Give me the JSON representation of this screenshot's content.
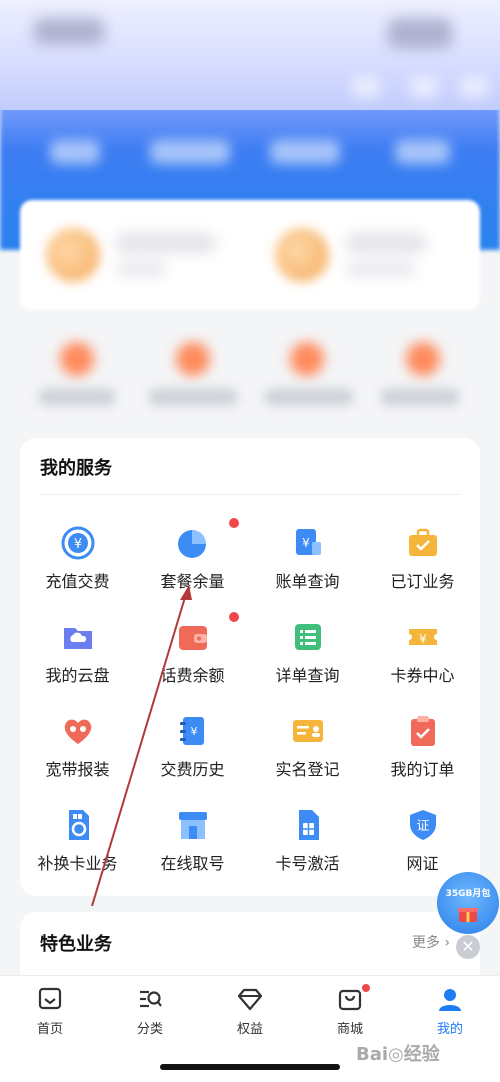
{
  "services": {
    "title": "我的服务",
    "items": [
      {
        "label": "充值交费",
        "icon": "recharge-icon",
        "badge": false
      },
      {
        "label": "套餐余量",
        "icon": "pie-chart-icon",
        "badge": true
      },
      {
        "label": "账单查询",
        "icon": "bill-icon",
        "badge": false
      },
      {
        "label": "已订业务",
        "icon": "briefcase-icon",
        "badge": false
      },
      {
        "label": "我的云盘",
        "icon": "cloud-folder-icon",
        "badge": false
      },
      {
        "label": "话费余额",
        "icon": "wallet-icon",
        "badge": true
      },
      {
        "label": "详单查询",
        "icon": "list-icon",
        "badge": false
      },
      {
        "label": "卡券中心",
        "icon": "coupon-icon",
        "badge": false
      },
      {
        "label": "宽带报装",
        "icon": "heart-icon",
        "badge": false
      },
      {
        "label": "交费历史",
        "icon": "history-icon",
        "badge": false
      },
      {
        "label": "实名登记",
        "icon": "id-card-icon",
        "badge": false
      },
      {
        "label": "我的订单",
        "icon": "clipboard-check-icon",
        "badge": false
      },
      {
        "label": "补换卡业务",
        "icon": "sim-swap-icon",
        "badge": false
      },
      {
        "label": "在线取号",
        "icon": "store-icon",
        "badge": false
      },
      {
        "label": "卡号激活",
        "icon": "sim-card-icon",
        "badge": false
      },
      {
        "label": "网证",
        "icon": "shield-cert-icon",
        "badge": false
      }
    ]
  },
  "featured": {
    "title": "特色业务",
    "more": "更多 ›"
  },
  "promo": {
    "text": "35GB月包",
    "close": "✕"
  },
  "tabs": [
    {
      "label": "首页",
      "icon": "home-icon",
      "active": false
    },
    {
      "label": "分类",
      "icon": "category-search-icon",
      "active": false,
      "badge": false
    },
    {
      "label": "权益",
      "icon": "diamond-icon",
      "active": false
    },
    {
      "label": "商城",
      "icon": "shop-bag-icon",
      "active": false,
      "badge": true
    },
    {
      "label": "我的",
      "icon": "profile-icon",
      "active": true
    }
  ],
  "watermark": "Bai◎经验",
  "colors": {
    "accent": "#1e7cf2",
    "badge": "#f04848",
    "arrow": "#b23a3a"
  }
}
